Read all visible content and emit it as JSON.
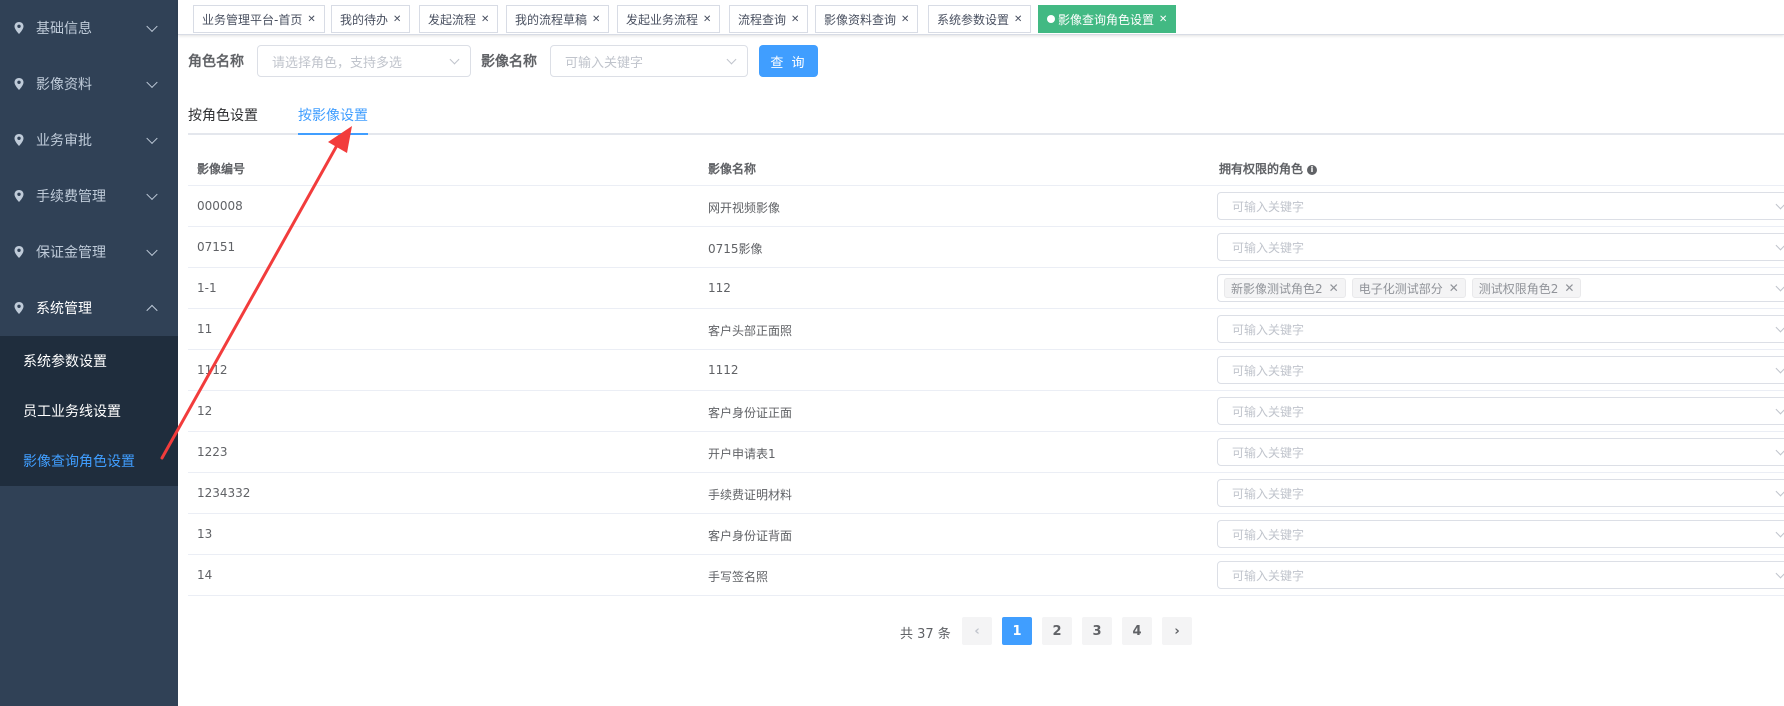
{
  "sidebar": {
    "menus": [
      {
        "label": "基础信息"
      },
      {
        "label": "影像资料"
      },
      {
        "label": "业务审批"
      },
      {
        "label": "手续费管理"
      },
      {
        "label": "保证金管理"
      },
      {
        "label": "系统管理"
      }
    ],
    "submenu": [
      {
        "label": "系统参数设置"
      },
      {
        "label": "员工业务线设置"
      },
      {
        "label": "影像查询角色设置"
      }
    ]
  },
  "tags": [
    {
      "label": "业务管理平台-首页"
    },
    {
      "label": "我的待办"
    },
    {
      "label": "发起流程"
    },
    {
      "label": "我的流程草稿"
    },
    {
      "label": "发起业务流程"
    },
    {
      "label": "流程查询"
    },
    {
      "label": "影像资料查询"
    },
    {
      "label": "系统参数设置"
    },
    {
      "label": "影像查询角色设置"
    }
  ],
  "filter": {
    "role_label": "角色名称",
    "role_placeholder": "请选择角色，支持多选",
    "image_label": "影像名称",
    "image_placeholder": "可输入关键字",
    "query_button": "查 询"
  },
  "view_tabs": {
    "by_role": "按角色设置",
    "by_image": "按影像设置"
  },
  "table": {
    "headers": {
      "code": "影像编号",
      "name": "影像名称",
      "roles": "拥有权限的角色"
    },
    "placeholder": "可输入关键字",
    "rows": [
      {
        "code": "000008",
        "name": "网开视频影像"
      },
      {
        "code": "07151",
        "name": "0715影像"
      },
      {
        "code": "1-1",
        "name": "112",
        "tags": [
          "新影像测试角色2",
          "电子化测试部分",
          "测试权限角色2"
        ]
      },
      {
        "code": "11",
        "name": "客户头部正面照"
      },
      {
        "code": "1112",
        "name": "1112"
      },
      {
        "code": "12",
        "name": "客户身份证正面"
      },
      {
        "code": "1223",
        "name": "开户申请表1"
      },
      {
        "code": "1234332",
        "name": "手续费证明材料"
      },
      {
        "code": "13",
        "name": "客户身份证背面"
      },
      {
        "code": "14",
        "name": "手写签名照"
      }
    ]
  },
  "pagination": {
    "total": "共 37 条",
    "pages": [
      "1",
      "2",
      "3",
      "4"
    ],
    "current": "1",
    "prev_icon": "‹",
    "next_icon": "›"
  },
  "colors": {
    "sidebar_bg": "#304156",
    "submenu_bg": "#1f2d3d",
    "primary": "#409eff",
    "active_tag": "#42b983",
    "annotation_arrow": "#f23c3c"
  }
}
